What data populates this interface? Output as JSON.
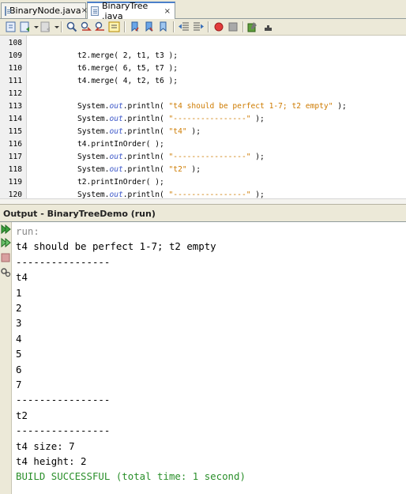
{
  "tabs": [
    {
      "label": "BinaryNode.java",
      "close": "×"
    },
    {
      "label": "BinaryTree .java",
      "close": "×"
    }
  ],
  "toolbar": {
    "icons": [
      "last-edit-icon",
      "back-history-icon",
      "forward-history-icon",
      "find-icon",
      "find-previous-icon",
      "find-next-icon",
      "toggle-highlight-icon",
      "previous-bookmark-icon",
      "next-bookmark-icon",
      "toggle-bookmark-icon",
      "shift-left-icon",
      "shift-right-icon",
      "start-macro-icon",
      "stop-macro-icon",
      "comment-icon",
      "uncomment-icon"
    ]
  },
  "editor": {
    "lines": [
      {
        "n": "108",
        "segs": []
      },
      {
        "n": "109",
        "segs": [
          {
            "t": "t2.merge( 2, t1, t3 );",
            "c": ""
          }
        ]
      },
      {
        "n": "110",
        "segs": [
          {
            "t": "t6.merge( 6, t5, t7 );",
            "c": ""
          }
        ]
      },
      {
        "n": "111",
        "segs": [
          {
            "t": "t4.merge( 4, t2, t6 );",
            "c": ""
          }
        ]
      },
      {
        "n": "112",
        "segs": []
      },
      {
        "n": "113",
        "segs": [
          {
            "t": "System.",
            "c": ""
          },
          {
            "t": "out",
            "c": "fld"
          },
          {
            "t": ".println( ",
            "c": ""
          },
          {
            "t": "\"t4 should be perfect 1-7; t2 empty\"",
            "c": "str"
          },
          {
            "t": " );",
            "c": ""
          }
        ]
      },
      {
        "n": "114",
        "segs": [
          {
            "t": "System.",
            "c": ""
          },
          {
            "t": "out",
            "c": "fld"
          },
          {
            "t": ".println( ",
            "c": ""
          },
          {
            "t": "\"----------------\"",
            "c": "str"
          },
          {
            "t": " );",
            "c": ""
          }
        ]
      },
      {
        "n": "115",
        "segs": [
          {
            "t": "System.",
            "c": ""
          },
          {
            "t": "out",
            "c": "fld"
          },
          {
            "t": ".println( ",
            "c": ""
          },
          {
            "t": "\"t4\"",
            "c": "str"
          },
          {
            "t": " );",
            "c": ""
          }
        ]
      },
      {
        "n": "116",
        "segs": [
          {
            "t": "t4.printInOrder( );",
            "c": ""
          }
        ]
      },
      {
        "n": "117",
        "segs": [
          {
            "t": "System.",
            "c": ""
          },
          {
            "t": "out",
            "c": "fld"
          },
          {
            "t": ".println( ",
            "c": ""
          },
          {
            "t": "\"----------------\"",
            "c": "str"
          },
          {
            "t": " );",
            "c": ""
          }
        ]
      },
      {
        "n": "118",
        "segs": [
          {
            "t": "System.",
            "c": ""
          },
          {
            "t": "out",
            "c": "fld"
          },
          {
            "t": ".println( ",
            "c": ""
          },
          {
            "t": "\"t2\"",
            "c": "str"
          },
          {
            "t": " );",
            "c": ""
          }
        ]
      },
      {
        "n": "119",
        "segs": [
          {
            "t": "t2.printInOrder( );",
            "c": ""
          }
        ]
      },
      {
        "n": "120",
        "segs": [
          {
            "t": "System.",
            "c": ""
          },
          {
            "t": "out",
            "c": "fld"
          },
          {
            "t": ".println( ",
            "c": ""
          },
          {
            "t": "\"----------------\"",
            "c": "str"
          },
          {
            "t": " );",
            "c": ""
          }
        ]
      }
    ]
  },
  "output": {
    "title": "Output - BinaryTreeDemo (run)",
    "side_icons": [
      "rerun-icon",
      "rerun-with-args-icon",
      "stop-icon",
      "settings-icon"
    ],
    "lines": [
      {
        "text": "run:",
        "style": "grey"
      },
      {
        "text": "t4 should be perfect 1-7; t2 empty",
        "style": ""
      },
      {
        "text": "----------------",
        "style": ""
      },
      {
        "text": "t4",
        "style": ""
      },
      {
        "text": "1",
        "style": ""
      },
      {
        "text": "2",
        "style": ""
      },
      {
        "text": "3",
        "style": ""
      },
      {
        "text": "4",
        "style": ""
      },
      {
        "text": "5",
        "style": ""
      },
      {
        "text": "6",
        "style": ""
      },
      {
        "text": "7",
        "style": ""
      },
      {
        "text": "----------------",
        "style": ""
      },
      {
        "text": "t2",
        "style": ""
      },
      {
        "text": "----------------",
        "style": ""
      },
      {
        "text": "t4 size: 7",
        "style": ""
      },
      {
        "text": "t4 height: 2",
        "style": ""
      },
      {
        "text": "BUILD SUCCESSFUL (total time: 1 second)",
        "style": "green"
      }
    ]
  }
}
